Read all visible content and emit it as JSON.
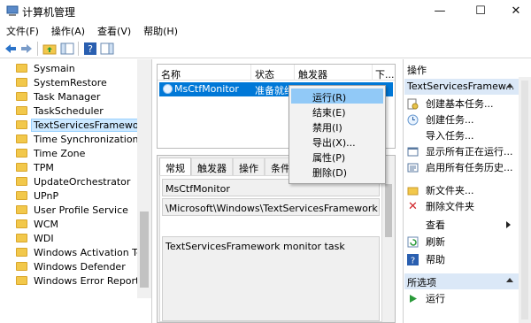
{
  "window": {
    "title": "计算机管理",
    "min": "—",
    "max": "☐",
    "close": "✕"
  },
  "menu": [
    "文件(F)",
    "操作(A)",
    "查看(V)",
    "帮助(H)"
  ],
  "tree": {
    "items": [
      "Sysmain",
      "SystemRestore",
      "Task Manager",
      "TaskScheduler",
      "TextServicesFramework",
      "Time Synchronization",
      "Time Zone",
      "TPM",
      "UpdateOrchestrator",
      "UPnP",
      "User Profile Service",
      "WCM",
      "WDI",
      "Windows Activation Techr",
      "Windows Defender",
      "Windows Error Reporting"
    ],
    "selected_index": 4
  },
  "task_list": {
    "columns": [
      "名称",
      "状态",
      "触发器",
      "下..."
    ],
    "row": {
      "name": "MsCtfMonitor",
      "status": "准备就绪"
    }
  },
  "context_menu": {
    "items": [
      "运行(R)",
      "结束(E)",
      "禁用(I)",
      "导出(X)...",
      "属性(P)",
      "删除(D)"
    ],
    "highlighted_index": 0
  },
  "detail": {
    "tabs": [
      "常规",
      "触发器",
      "操作",
      "条件"
    ],
    "name_value": "MsCtfMonitor",
    "path_value": "\\Microsoft\\Windows\\TextServicesFramework",
    "description_value": "TextServicesFramework monitor task"
  },
  "actions": {
    "title": "操作",
    "section1": "TextServicesFramew...",
    "items1": [
      {
        "label": "创建基本任务...",
        "icon": "wizard-icon"
      },
      {
        "label": "创建任务...",
        "icon": "create-task-icon"
      },
      {
        "label": "导入任务...",
        "icon": "none"
      },
      {
        "label": "显示所有正在运行...",
        "icon": "running-tasks-icon"
      },
      {
        "label": "启用所有任务历史...",
        "icon": "history-icon"
      },
      {
        "label": "新文件夹...",
        "icon": "new-folder-icon"
      },
      {
        "label": "删除文件夹",
        "icon": "delete-icon"
      },
      {
        "label": "查看",
        "icon": "none"
      },
      {
        "label": "刷新",
        "icon": "refresh-icon"
      },
      {
        "label": "帮助",
        "icon": "help-icon"
      }
    ],
    "section2": "所选项",
    "items2": [
      {
        "label": "运行",
        "icon": "run-icon"
      }
    ]
  },
  "colors": {
    "selection": "#0078d7",
    "action_header": "#dbe8f7",
    "folder": "#f2c84b",
    "context_highlight": "#91c9f7"
  }
}
